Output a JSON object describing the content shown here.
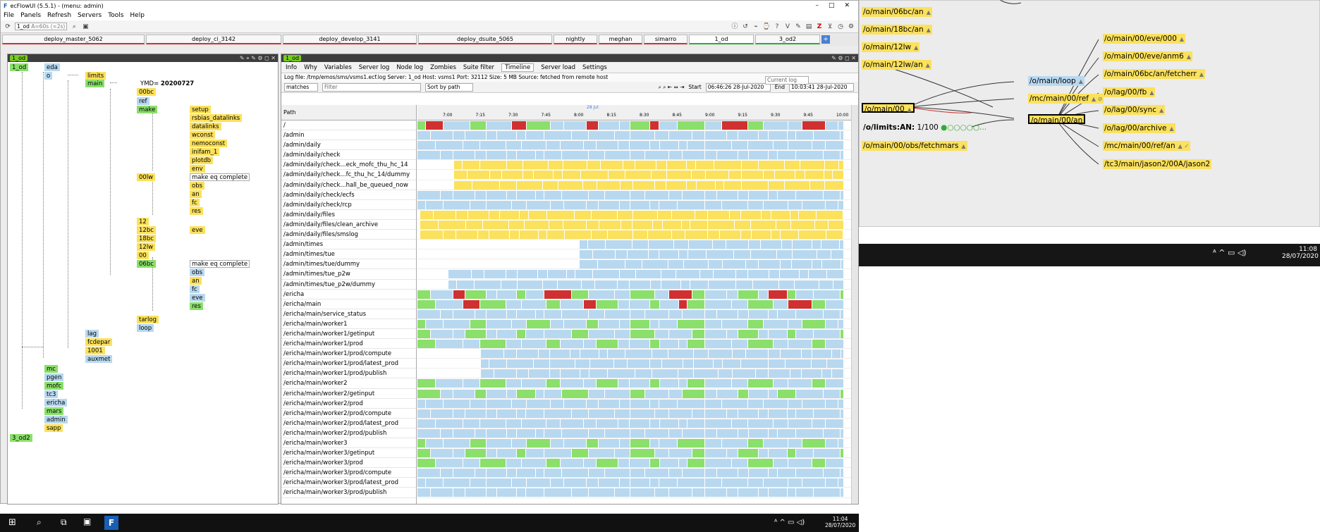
{
  "window": {
    "title": "ecFlowUI (5.5.1) - (menu: admin)",
    "minimize": "–",
    "maximize": "□",
    "close": "✕"
  },
  "menu": [
    "File",
    "Panels",
    "Refresh",
    "Servers",
    "Tools",
    "Help"
  ],
  "toolbar": {
    "server_label": "1_od",
    "server_extra": "A=60s (=2s)"
  },
  "server_tabs": [
    "deploy_master_5062",
    "deploy_ci_3142",
    "deploy_develop_3141",
    "deploy_dsuite_5065",
    "nightly",
    "meghan",
    "simarro",
    "1_od",
    "3_od2"
  ],
  "left_panel": {
    "tag": "1_od",
    "ctl": "✎ ⌖ ✎ ⚙ ◻ ✕"
  },
  "tree": {
    "root": "1_od",
    "eda": "eda",
    "o": "o",
    "limits": "limits",
    "main": "main",
    "ymd_label": "YMD=",
    "ymd_value": "20200727",
    "n00bc": "00bc",
    "ref": "ref",
    "make": "make",
    "setup": "setup",
    "rsbias": "rsbias_datalinks",
    "datalinks": "datalinks",
    "wconst": "wconst",
    "nemoconst": "nemoconst",
    "inifam": "inifam_1",
    "plotdb": "plotdb",
    "env": "env",
    "n00lw": "00lw",
    "make_eq": "make eq complete",
    "obs": "obs",
    "an": "an",
    "fc": "fc",
    "res": "res",
    "n12": "12",
    "n12bc": "12bc",
    "eve": "eve",
    "n18bc": "18bc",
    "n12lw": "12lw",
    "n00": "00",
    "n06bc": "06bc",
    "make_eq2": "make eq complete",
    "obs2": "obs",
    "an2": "an",
    "fc2": "fc",
    "eve2": "eve",
    "res2": "res",
    "tarlog": "tarlog",
    "loop": "loop",
    "lag": "lag",
    "fcdepar": "fcdepar",
    "n1001": "1001",
    "auxmet": "auxmet",
    "mc": "mc",
    "pgen": "pgen",
    "mofc": "mofc",
    "tc3": "tc3",
    "ericha": "ericha",
    "mars": "mars",
    "admin": "admin",
    "sapp": "sapp",
    "od2": "3_od2"
  },
  "right_panel": {
    "tag": "1_od",
    "tabs": [
      "Info",
      "Why",
      "Variables",
      "Server log",
      "Node log",
      "Zombies",
      "Suite filter",
      "Timeline",
      "Server load",
      "Settings"
    ],
    "loginfo": "Log file: /tmp/emos/sms/vsms1.ecf.log Server: 1_od Host: vsms1 Port: 32112 Size: 5 MB Source: fetched from remote host",
    "current_log": "Current log",
    "matches": "matches",
    "filter_placeholder": "Filter",
    "sort": "Sort by path",
    "start_label": "Start",
    "start_value": "06:46:26 28-Jul-2020",
    "end_label": "End",
    "end_value": "10:03:41 28-Jul-2020",
    "path_header": "Path",
    "date_label": "28 Jul",
    "ticks": [
      "7:00",
      "7:15",
      "7:30",
      "7:45",
      "8:00",
      "8:15",
      "8:30",
      "8:45",
      "9:00",
      "9:15",
      "9:30",
      "9:45",
      "10:00"
    ],
    "paths": [
      "/",
      "/admin",
      "/admin/daily",
      "/admin/daily/check",
      "/admin/daily/check...eck_mofc_thu_hc_14",
      "/admin/daily/check...fc_thu_hc_14/dummy",
      "/admin/daily/check...hall_be_queued_now",
      "/admin/daily/check/ecfs",
      "/admin/daily/check/rcp",
      "/admin/daily/files",
      "/admin/daily/files/clean_archive",
      "/admin/daily/files/smslog",
      "/admin/times",
      "/admin/times/tue",
      "/admin/times/tue/dummy",
      "/admin/times/tue_p2w",
      "/admin/times/tue_p2w/dummy",
      "/ericha",
      "/ericha/main",
      "/ericha/main/service_status",
      "/ericha/main/worker1",
      "/ericha/main/worker1/getinput",
      "/ericha/main/worker1/prod",
      "/ericha/main/worker1/prod/compute",
      "/ericha/main/worker1/prod/latest_prod",
      "/ericha/main/worker1/prod/publish",
      "/ericha/main/worker2",
      "/ericha/main/worker2/getinput",
      "/ericha/main/worker2/prod",
      "/ericha/main/worker2/prod/compute",
      "/ericha/main/worker2/prod/latest_prod",
      "/ericha/main/worker2/prod/publish",
      "/ericha/main/worker3",
      "/ericha/main/worker3/getinput",
      "/ericha/main/worker3/prod",
      "/ericha/main/worker3/prod/compute",
      "/ericha/main/worker3/prod/latest_prod",
      "/ericha/main/worker3/prod/publish"
    ]
  },
  "graph": {
    "left_nodes": [
      "/o/main/06bc/an",
      "/o/main/18bc/an",
      "/o/main/12lw",
      "/o/main/12lw/an"
    ],
    "center": "/o/main/00",
    "limit_label": "/o/limits:AN:",
    "limit_value": "1/100",
    "fetchmars": "/o/main/00/obs/fetchmars",
    "mid_nodes": [
      "/o/main/loop",
      "/mc/main/00/ref",
      "/o/main/00/an"
    ],
    "right_nodes": [
      "/o/main/00/eve/000",
      "/o/main/00/eve/anm6",
      "/o/main/06bc/an/fetcherr",
      "/o/lag/00/fb",
      "/o/lag/00/sync",
      "/o/lag/00/archive",
      "/mc/main/00/ref/an",
      "/tc3/main/jason2/00A/jason2"
    ]
  },
  "tray_top": {
    "time": "11:08",
    "date": "28/07/2020"
  },
  "tray_bottom": {
    "time": "11:04",
    "date": "28/07/2020"
  },
  "colors": {
    "green": "#8bdf6b",
    "yellow": "#fbe15c",
    "blue": "#b8d8f0",
    "red": "#d03030"
  }
}
